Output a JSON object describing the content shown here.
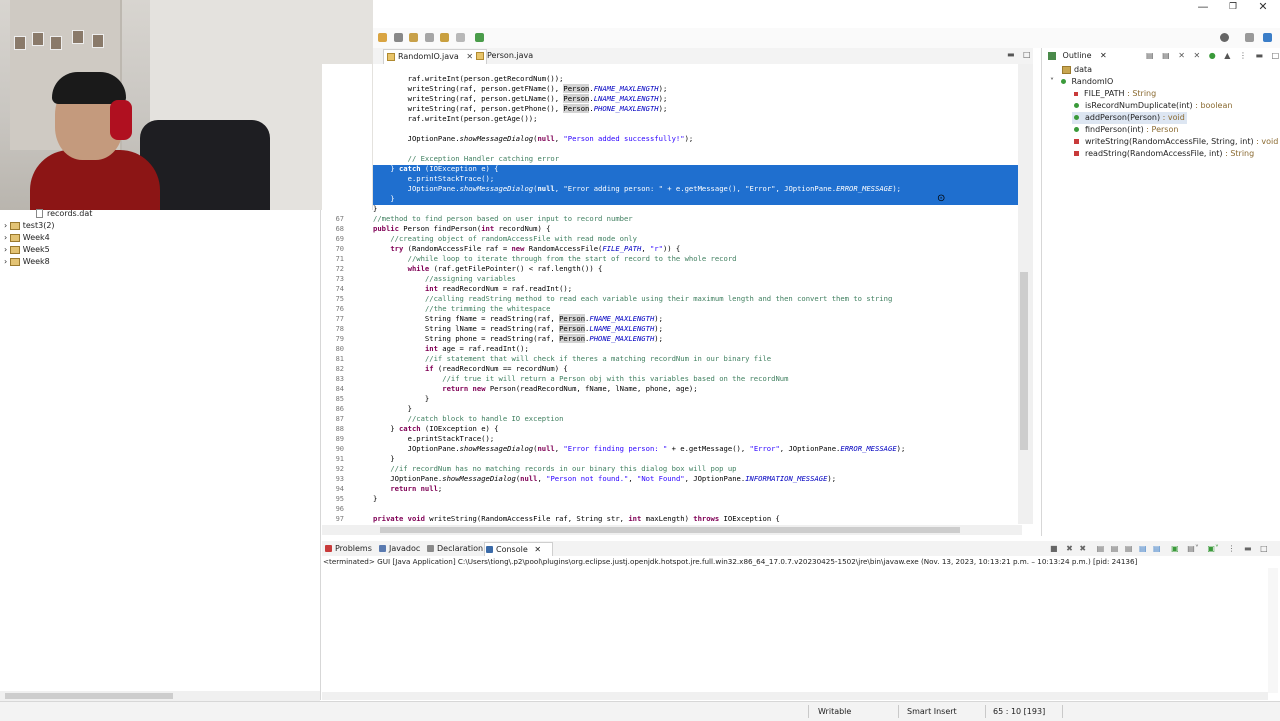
{
  "window": {
    "minimize_icon": "—",
    "restore_icon": "❐",
    "close_icon": "✕"
  },
  "editor": {
    "tabs": [
      {
        "label": "RandomIO.java",
        "active": true,
        "close": "✕"
      },
      {
        "label": "Person.java",
        "active": false
      }
    ],
    "lines": [
      {
        "n": "",
        "text": "        raf.writeInt(person.getRecordNum());"
      },
      {
        "n": "",
        "text": "        writeString(raf, person.getFName(), Person.FNAME_MAXLENGTH);"
      },
      {
        "n": "",
        "text": "        writeString(raf, person.getLName(), Person.LNAME_MAXLENGTH);"
      },
      {
        "n": "",
        "text": "        writeString(raf, person.getPhone(), Person.PHONE_MAXLENGTH);"
      },
      {
        "n": "",
        "text": "        raf.writeInt(person.getAge());"
      },
      {
        "n": "",
        "text": ""
      },
      {
        "n": "",
        "text": "        JOptionPane.showMessageDialog(null, \"Person added successfully!\");"
      },
      {
        "n": "",
        "text": ""
      },
      {
        "n": "",
        "text": "        // Exception Handler catching error"
      },
      {
        "n": "",
        "text": "    } catch (IOException e) {"
      },
      {
        "n": "",
        "text": "        e.printStackTrace();"
      },
      {
        "n": "",
        "text": "        JOptionPane.showMessageDialog(null, \"Error adding person: \" + e.getMessage(), \"Error\", JOptionPane.ERROR_MESSAGE);"
      },
      {
        "n": "",
        "text": "    }"
      },
      {
        "n": "",
        "text": "}"
      },
      {
        "n": "67",
        "text": "//method to find person based on user input to record number"
      },
      {
        "n": "68",
        "text": "public Person findPerson(int recordNum) {"
      },
      {
        "n": "69",
        "text": "    //creating object of randomAccessFile with read mode only"
      },
      {
        "n": "70",
        "text": "    try (RandomAccessFile raf = new RandomAccessFile(FILE_PATH, \"r\")) {"
      },
      {
        "n": "71",
        "text": "        //while loop to iterate through from the start of record to the whole record"
      },
      {
        "n": "72",
        "text": "        while (raf.getFilePointer() < raf.length()) {"
      },
      {
        "n": "73",
        "text": "            //assigning variables"
      },
      {
        "n": "74",
        "text": "            int readRecordNum = raf.readInt();"
      },
      {
        "n": "75",
        "text": "            //calling readString method to read each variable using their maximum length and then convert them to string"
      },
      {
        "n": "76",
        "text": "            //the trimming the whitespace"
      },
      {
        "n": "77",
        "text": "            String fName = readString(raf, Person.FNAME_MAXLENGTH);"
      },
      {
        "n": "78",
        "text": "            String lName = readString(raf, Person.LNAME_MAXLENGTH);"
      },
      {
        "n": "79",
        "text": "            String phone = readString(raf, Person.PHONE_MAXLENGTH);"
      },
      {
        "n": "80",
        "text": "            int age = raf.readInt();"
      },
      {
        "n": "81",
        "text": "            //if statement that will check if theres a matching recordNum in our binary file"
      },
      {
        "n": "82",
        "text": "            if (readRecordNum == recordNum) {"
      },
      {
        "n": "83",
        "text": "                //if true it will return a Person obj with this variables based on the recordNum"
      },
      {
        "n": "84",
        "text": "                return new Person(readRecordNum, fName, lName, phone, age);"
      },
      {
        "n": "85",
        "text": "            }"
      },
      {
        "n": "86",
        "text": "        }"
      },
      {
        "n": "87",
        "text": "        //catch block to handle IO exception"
      },
      {
        "n": "88",
        "text": "    } catch (IOException e) {"
      },
      {
        "n": "89",
        "text": "        e.printStackTrace();"
      },
      {
        "n": "90",
        "text": "        JOptionPane.showMessageDialog(null, \"Error finding person: \" + e.getMessage(), \"Error\", JOptionPane.ERROR_MESSAGE);"
      },
      {
        "n": "91",
        "text": "    }"
      },
      {
        "n": "92",
        "text": "    //if recordNum has no matching records in our binary this dialog box will pop up"
      },
      {
        "n": "93",
        "text": "    JOptionPane.showMessageDialog(null, \"Person not found.\", \"Not Found\", JOptionPane.INFORMATION_MESSAGE);"
      },
      {
        "n": "94",
        "text": "    return null;"
      },
      {
        "n": "95",
        "text": "}"
      },
      {
        "n": "96",
        "text": ""
      },
      {
        "n": "97",
        "text": "private void writeString(RandomAccessFile raf, String str, int maxLength) throws IOException {"
      }
    ]
  },
  "outline": {
    "title": "Outline",
    "close": "✕",
    "items": [
      {
        "label": "data",
        "type": "",
        "kind": "package"
      },
      {
        "label": "RandomIO",
        "type": "",
        "kind": "class"
      },
      {
        "label": "FILE_PATH",
        "type": " : String",
        "kind": "field"
      },
      {
        "label": "isRecordNumDuplicate(int)",
        "type": " : boolean",
        "kind": "public"
      },
      {
        "label": "addPerson(Person)",
        "type": " : void",
        "kind": "public"
      },
      {
        "label": "findPerson(int)",
        "type": " : Person",
        "kind": "public"
      },
      {
        "label": "writeString(RandomAccessFile, String, int)",
        "type": " : void",
        "kind": "private"
      },
      {
        "label": "readString(RandomAccessFile, int)",
        "type": " : String",
        "kind": "private"
      }
    ]
  },
  "explorer": {
    "items": [
      {
        "label": "records.dat",
        "kind": "file"
      },
      {
        "label": "test3(2)",
        "kind": "project"
      },
      {
        "label": "Week4",
        "kind": "project"
      },
      {
        "label": "Week5",
        "kind": "project"
      },
      {
        "label": "Week8",
        "kind": "project"
      }
    ]
  },
  "bottom_panel": {
    "tabs": [
      {
        "label": "Problems",
        "active": false
      },
      {
        "label": "Javadoc",
        "active": false
      },
      {
        "label": "Declaration",
        "active": false
      },
      {
        "label": "Console",
        "active": true,
        "close": "✕"
      }
    ],
    "console_text": "<terminated> GUI [Java Application] C:\\Users\\tiong\\.p2\\pool\\plugins\\org.eclipse.justj.openjdk.hotspot.jre.full.win32.x86_64_17.0.7.v20230425-1502\\jre\\bin\\javaw.exe  (Nov. 13, 2023, 10:13:21 p.m. – 10:13:24 p.m.) [pid: 24136]"
  },
  "statusbar": {
    "writable": "Writable",
    "insert_mode": "Smart Insert",
    "position": "65 : 10 [193]"
  },
  "colors": {
    "selection": "#1f6fcf",
    "keyword": "#7f0055",
    "comment": "#3f7f5f",
    "string": "#2a00ff"
  }
}
